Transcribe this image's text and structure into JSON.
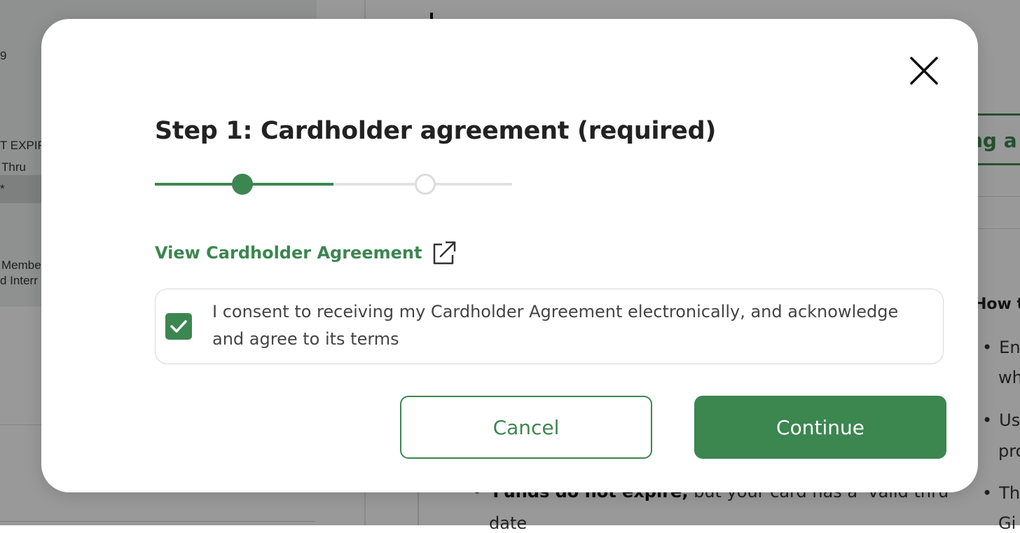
{
  "background": {
    "card_lines": [
      "9",
      "T EXPIF",
      "Thru",
      "*",
      "Membe",
      "d Interr"
    ],
    "tab_partial": "ng a",
    "how_heading": "How t",
    "bullets": [
      "En",
      "Us",
      "Th"
    ],
    "bullet_continuations": [
      "wh",
      "pro",
      "Gi"
    ],
    "funds_bold": "Funds do not expire,",
    "funds_rest": " but your card has a ‘valid thru’",
    "funds_continuation": "date"
  },
  "modal": {
    "title": "Step 1: Cardholder agreement (required)",
    "stepper": {
      "steps": 2,
      "current_step": 1,
      "progress_fraction": 0.5
    },
    "view_link_label": "View Cardholder Agreement",
    "view_link_icon": "external-link-icon",
    "consent": {
      "checked": true,
      "text": "I consent to receiving my Cardholder Agreement electronically, and acknowledge and agree to its terms"
    },
    "cancel_label": "Cancel",
    "continue_label": "Continue",
    "close_icon": "close-icon"
  },
  "colors": {
    "accent": "#3c8650",
    "overlay": "rgba(0,0,0,0.4)",
    "title": "#222222",
    "border": "#d8d8d8"
  }
}
